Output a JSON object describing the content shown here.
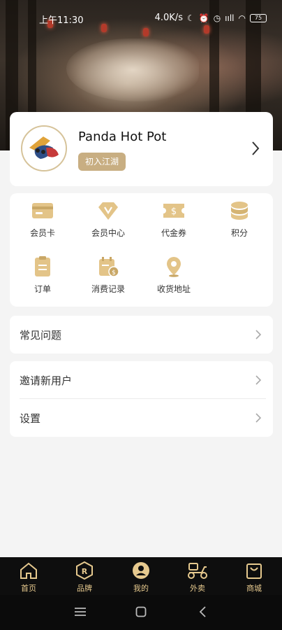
{
  "status_bar": {
    "time": "上午11:30",
    "network_speed": "4.0K/s",
    "signal_text": "ııll",
    "battery": "75"
  },
  "profile": {
    "name": "Panda Hot Pot",
    "badge": "初入江湖"
  },
  "grid_items": [
    {
      "label": "会员卡",
      "icon": "member-card-icon"
    },
    {
      "label": "会员中心",
      "icon": "diamond-icon"
    },
    {
      "label": "代金券",
      "icon": "voucher-icon"
    },
    {
      "label": "积分",
      "icon": "coins-icon"
    },
    {
      "label": "订单",
      "icon": "order-icon"
    },
    {
      "label": "消费记录",
      "icon": "calendar-dollar-icon"
    },
    {
      "label": "收货地址",
      "icon": "location-pin-icon"
    }
  ],
  "list_faq": {
    "label": "常见问题"
  },
  "list_invite": {
    "label": "邀请新用户"
  },
  "list_settings": {
    "label": "设置"
  },
  "tabs": [
    {
      "label": "首页",
      "icon": "home-icon"
    },
    {
      "label": "品牌",
      "icon": "brand-icon"
    },
    {
      "label": "我的",
      "icon": "user-icon"
    },
    {
      "label": "外卖",
      "icon": "scooter-icon"
    },
    {
      "label": "商城",
      "icon": "shopping-bag-icon"
    }
  ],
  "colors": {
    "gold": "#d9b877",
    "badge": "#c8ae82",
    "tabbar_bg": "#0e0e0e",
    "tab_text": "#e6c98e"
  }
}
